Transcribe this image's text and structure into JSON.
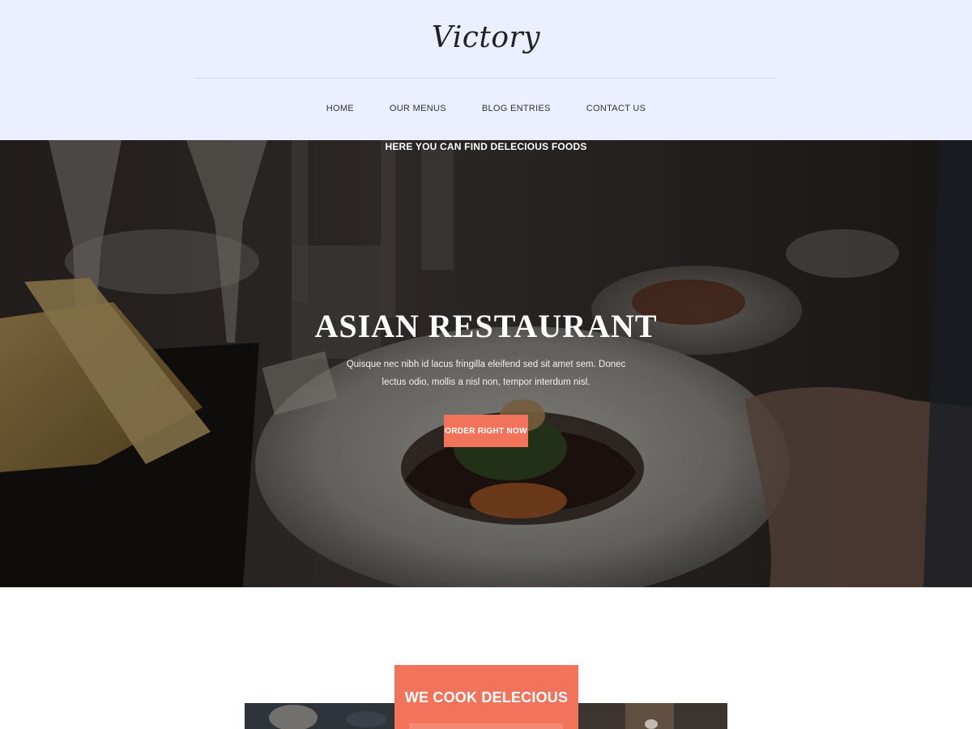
{
  "header": {
    "logo": "Victory",
    "nav": [
      {
        "label": "HOME"
      },
      {
        "label": "OUR MENUS"
      },
      {
        "label": "BLOG ENTRIES"
      },
      {
        "label": "CONTACT US"
      }
    ]
  },
  "hero": {
    "eyebrow": "HERE YOU CAN FIND DELECIOUS FOODS",
    "title": "ASIAN RESTAURANT",
    "description": "Quisque nec nibh id lacus fringilla eleifend sed sit amet sem. Donec lectus odio, mollis a nisl non, tempor interdum nisl.",
    "button_label": "ORDER RIGHT NOW"
  },
  "feature": {
    "title": "WE COOK DELECIOUS"
  },
  "colors": {
    "header_bg": "#ebefff",
    "accent": "#f2735b",
    "text_dark": "#222222",
    "white": "#ffffff"
  }
}
